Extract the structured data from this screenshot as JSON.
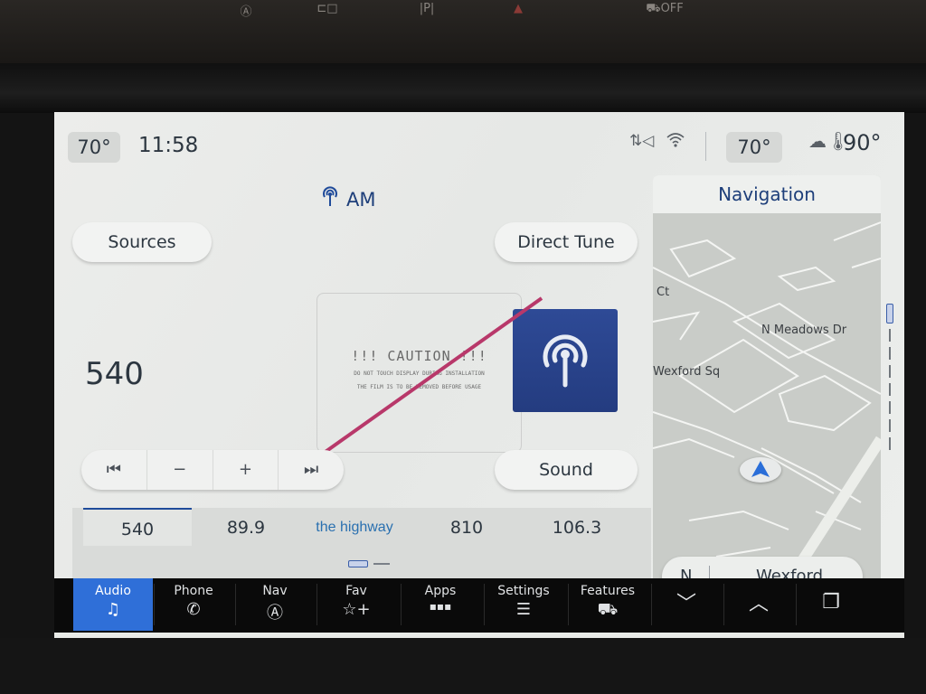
{
  "hardware_buttons": [
    {
      "name": "auto-start-stop",
      "glyph": "Ⓐ"
    },
    {
      "name": "camera",
      "glyph": "⊏□"
    },
    {
      "name": "park-assist",
      "glyph": "|P|"
    },
    {
      "name": "hazard",
      "glyph": "▲"
    },
    {
      "name": "traction-control-off",
      "glyph": "⛟OFF"
    }
  ],
  "status_bar": {
    "driver_temp": "70°",
    "time": "11:58",
    "passenger_temp": "70°",
    "outside_temp": "90°",
    "icons": [
      "data-transfer-icon",
      "wifi-icon",
      "weather-temp-icon"
    ]
  },
  "audio": {
    "band": "AM",
    "sources_label": "Sources",
    "direct_tune_label": "Direct Tune",
    "sound_label": "Sound",
    "frequency": "540",
    "transport": {
      "prev": "⏮",
      "minus": "−",
      "plus": "+",
      "next": "⏭"
    },
    "caution_sticker": {
      "title": "!!! CAUTION !!!",
      "line1": "DO NOT TOUCH DISPLAY DURING INSTALLATION",
      "line2": "THE FILM IS TO BE REMOVED BEFORE USAGE"
    },
    "presets": [
      {
        "label": "540",
        "active": true
      },
      {
        "label": "89.9",
        "active": false
      },
      {
        "label": "the highway",
        "logo": true,
        "active": false
      },
      {
        "label": "810",
        "active": false
      },
      {
        "label": "106.3",
        "active": false
      }
    ],
    "preset_page": 1,
    "preset_pages": 2
  },
  "navigation": {
    "title": "Navigation",
    "labels": {
      "ct": "Ct",
      "meadows": "N Meadows Dr",
      "wexford_sq": "Wexford Sq"
    },
    "heading": "N",
    "current_street": "Wexford"
  },
  "bottom_bar": {
    "tabs": [
      {
        "label": "Audio",
        "icon": "♫",
        "active": true
      },
      {
        "label": "Phone",
        "icon": "✆",
        "active": false
      },
      {
        "label": "Nav",
        "icon": "Ⓐ",
        "active": false
      },
      {
        "label": "Fav",
        "icon": "☆+",
        "active": false
      },
      {
        "label": "Apps",
        "icon": "▪▪▪",
        "active": false
      },
      {
        "label": "Settings",
        "icon": "☰",
        "active": false
      },
      {
        "label": "Features",
        "icon": "⛟",
        "active": false
      }
    ],
    "down_icon": "﹀",
    "up_icon": "︿",
    "windows_icon": "❐"
  }
}
